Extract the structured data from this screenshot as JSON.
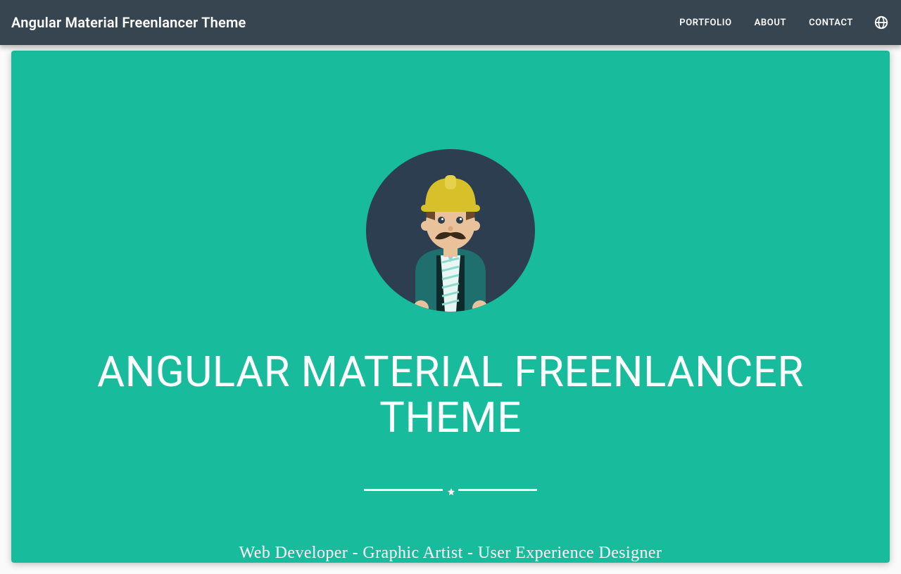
{
  "toolbar": {
    "title": "Angular Material Freenlancer Theme",
    "links": [
      {
        "label": "Portfolio"
      },
      {
        "label": "About"
      },
      {
        "label": "Contact"
      }
    ]
  },
  "hero": {
    "title": "Angular Material Freenlancer Theme",
    "subtitle": "Web Developer - Graphic Artist - User Experience Designer"
  },
  "colors": {
    "primary": "#36454f",
    "accent": "#18bb9c"
  }
}
